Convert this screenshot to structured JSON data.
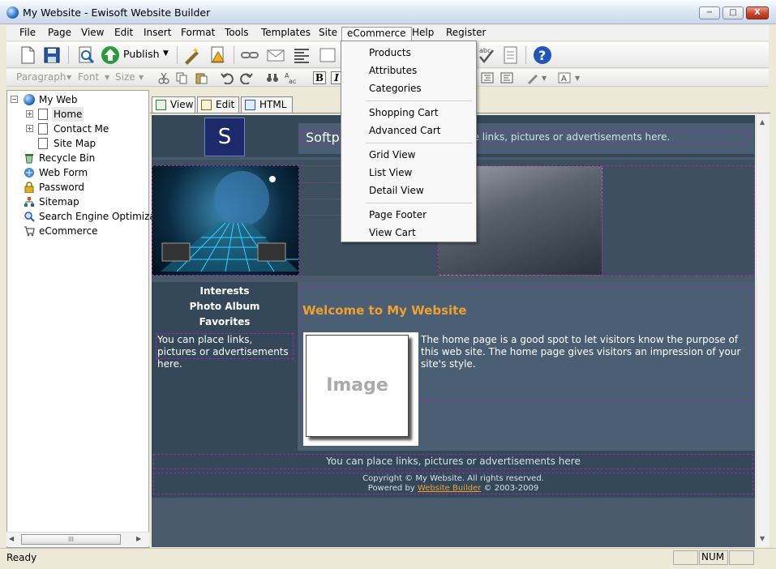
{
  "window": {
    "title": "My Website - Ewisoft Website Builder",
    "min_label": "−",
    "max_label": "□",
    "close_label": "X"
  },
  "menu": {
    "items": [
      "File",
      "Page",
      "View",
      "Edit",
      "Insert",
      "Format",
      "Tools",
      "Templates",
      "Site",
      "eCommerce",
      "Help",
      "Register"
    ]
  },
  "toolbar": {
    "publish_label": "Publish"
  },
  "format_toolbar": {
    "paragraph": "Paragraph",
    "font": "Font",
    "size": "Size",
    "bold": "B",
    "italic": "I"
  },
  "sidebar": {
    "items": [
      {
        "label": "My Web",
        "icon": "globe-icon"
      },
      {
        "label": "Home",
        "icon": "page-icon"
      },
      {
        "label": "Contact Me",
        "icon": "page-icon"
      },
      {
        "label": "Site Map",
        "icon": "page-icon"
      },
      {
        "label": "Recycle Bin",
        "icon": "recycle-bin-icon"
      },
      {
        "label": "Web Form",
        "icon": "web-form-icon"
      },
      {
        "label": "Password",
        "icon": "lock-icon"
      },
      {
        "label": "Sitemap",
        "icon": "sitemap-icon"
      },
      {
        "label": "Search Engine Optimizati",
        "icon": "search-icon"
      },
      {
        "label": "eCommerce",
        "icon": "cart-icon"
      }
    ],
    "scroll_grip": "III"
  },
  "editor_tabs": {
    "view": "View",
    "edit": "Edit",
    "html": "HTML"
  },
  "preview": {
    "logo_letter": "S",
    "banner_text_start": "Softp",
    "banner_text_end": "ce links, pictures or advertisements here.",
    "nav": [
      "Interests",
      "Photo Album",
      "Favorites"
    ],
    "sidebar_ad": "You can place links, pictures or advertisements here.",
    "heading": "Welcome to My Website",
    "image_placeholder": "Image",
    "body_text": "The home page is a good spot to let visitors know the purpose of this web site. The home page gives visitors an impression of your site's style.",
    "footer_ad": "You can place links, pictures or advertisements here",
    "copyright": "Copyright © My Website. All rights reserved.",
    "powered_prefix": "Powered by",
    "powered_link": "Website Builder",
    "powered_suffix": "© 2003-2009"
  },
  "dropdown": {
    "items": [
      "Products",
      "Attributes",
      "Categories",
      "Shopping Cart",
      "Advanced Cart",
      "Grid View",
      "List View",
      "Detail View",
      "Page Footer",
      "View Cart"
    ]
  },
  "status": {
    "text": "Ready",
    "num": "NUM"
  },
  "colors": {
    "accent": "#f0a030",
    "page_bg": "#4a5a6c",
    "dashed": "#9a2ca6"
  }
}
